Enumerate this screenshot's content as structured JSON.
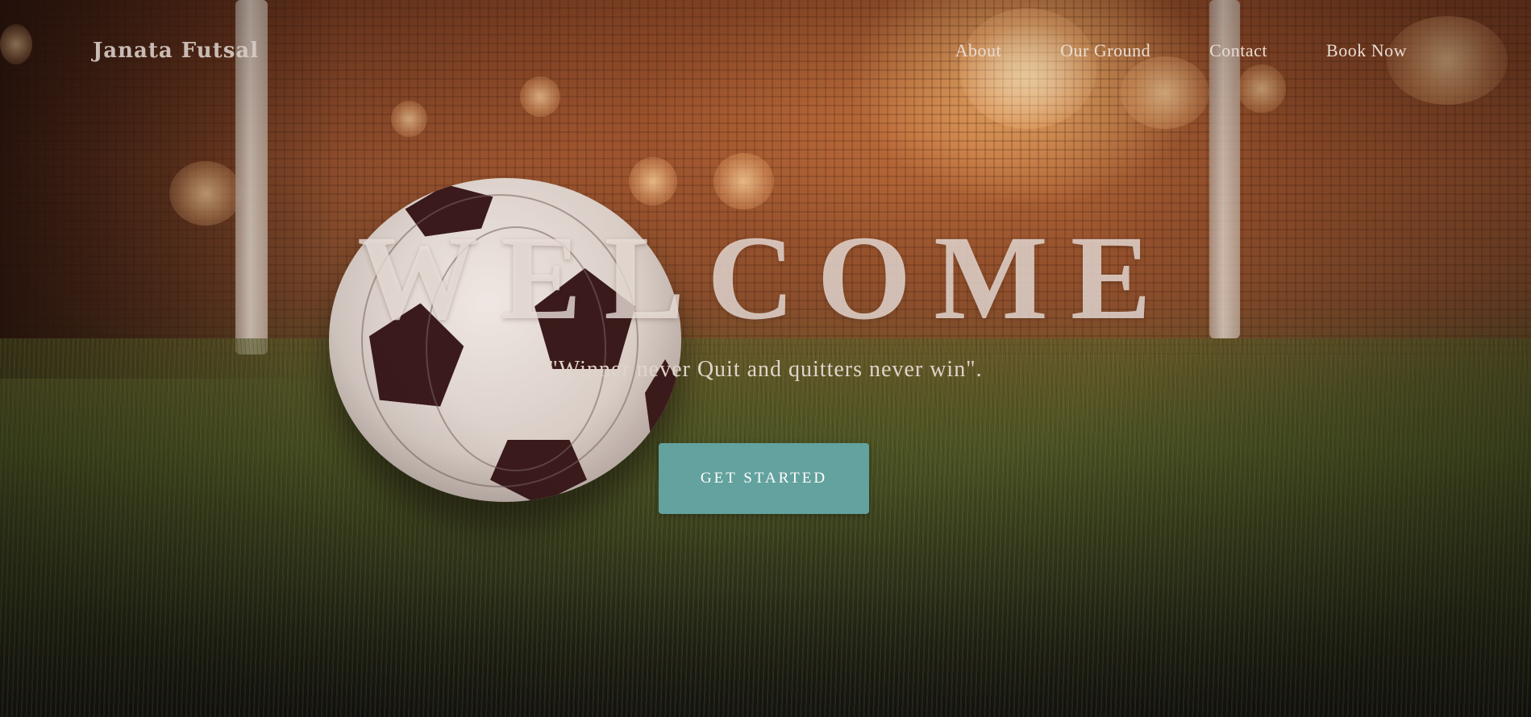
{
  "brand": {
    "name": "Janata Futsal"
  },
  "nav": {
    "items": [
      {
        "label": "About"
      },
      {
        "label": "Our Ground"
      },
      {
        "label": "Contact"
      },
      {
        "label": "Book Now"
      }
    ]
  },
  "hero": {
    "heading": "WELCOME",
    "tagline": "\"Winner never Quit and quitters never win\".",
    "cta_label": "GET STARTED",
    "background": "soccer-ball-on-grass-photo"
  },
  "colors": {
    "accent": "#63a29e",
    "text_light": "#eadcd2"
  }
}
